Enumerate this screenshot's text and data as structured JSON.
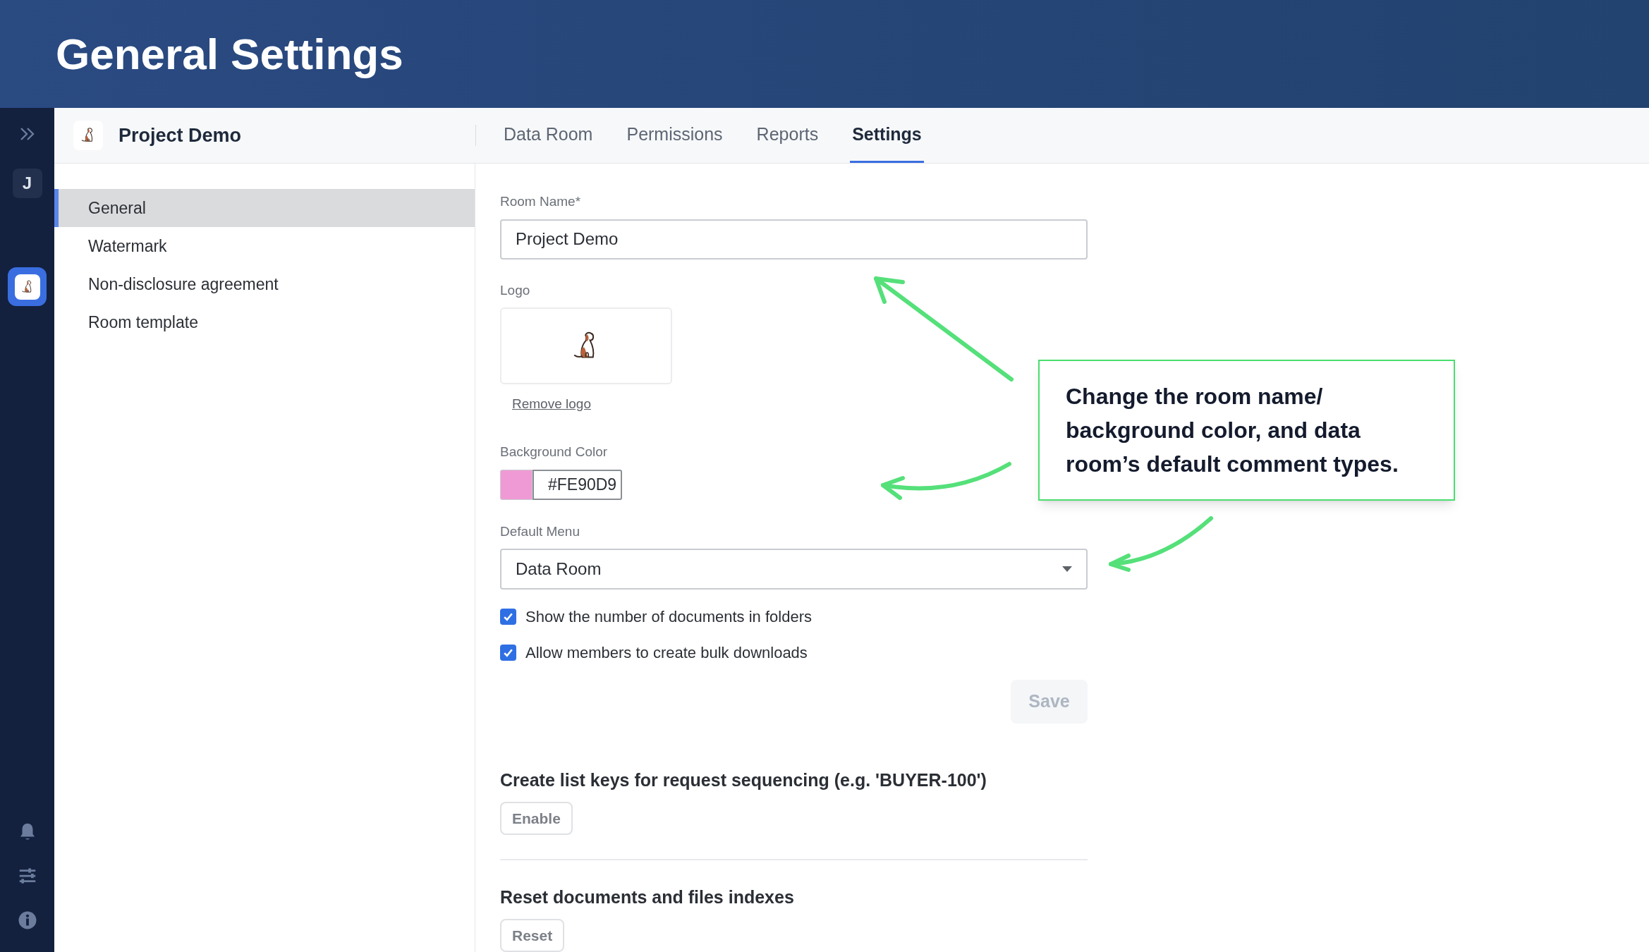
{
  "header": {
    "title": "General Settings"
  },
  "rail": {
    "avatar": "J",
    "items": [
      {
        "kind": "app",
        "selected": true
      }
    ]
  },
  "project": {
    "name": "Project Demo"
  },
  "tabs": [
    {
      "label": "Data Room",
      "selected": false
    },
    {
      "label": "Permissions",
      "selected": false
    },
    {
      "label": "Reports",
      "selected": false
    },
    {
      "label": "Settings",
      "selected": true
    }
  ],
  "submenu": [
    {
      "label": "General",
      "selected": true
    },
    {
      "label": "Watermark",
      "selected": false
    },
    {
      "label": "Non-disclosure agreement",
      "selected": false
    },
    {
      "label": "Room template",
      "selected": false
    }
  ],
  "form": {
    "room_name": {
      "label": "Room Name*",
      "value": "Project Demo"
    },
    "logo": {
      "label": "Logo",
      "remove_link": "Remove logo"
    },
    "background_color": {
      "label": "Background Color",
      "value": "#FE90D9",
      "color": "#f09ad5"
    },
    "default_menu": {
      "label": "Default Menu",
      "value": "Data Room"
    },
    "options": [
      {
        "label": "Show the number of documents in folders",
        "checked": true
      },
      {
        "label": "Allow members to create bulk downloads",
        "checked": true
      }
    ],
    "save": {
      "label": "Save",
      "disabled": true
    }
  },
  "sections": [
    {
      "title": "Create list keys for request sequencing (e.g. 'BUYER-100')",
      "button": "Enable"
    },
    {
      "title": "Reset documents and files indexes",
      "button": "Reset"
    }
  ],
  "callout": {
    "text": "Change the room name/ background color, and data room’s default comment types."
  }
}
